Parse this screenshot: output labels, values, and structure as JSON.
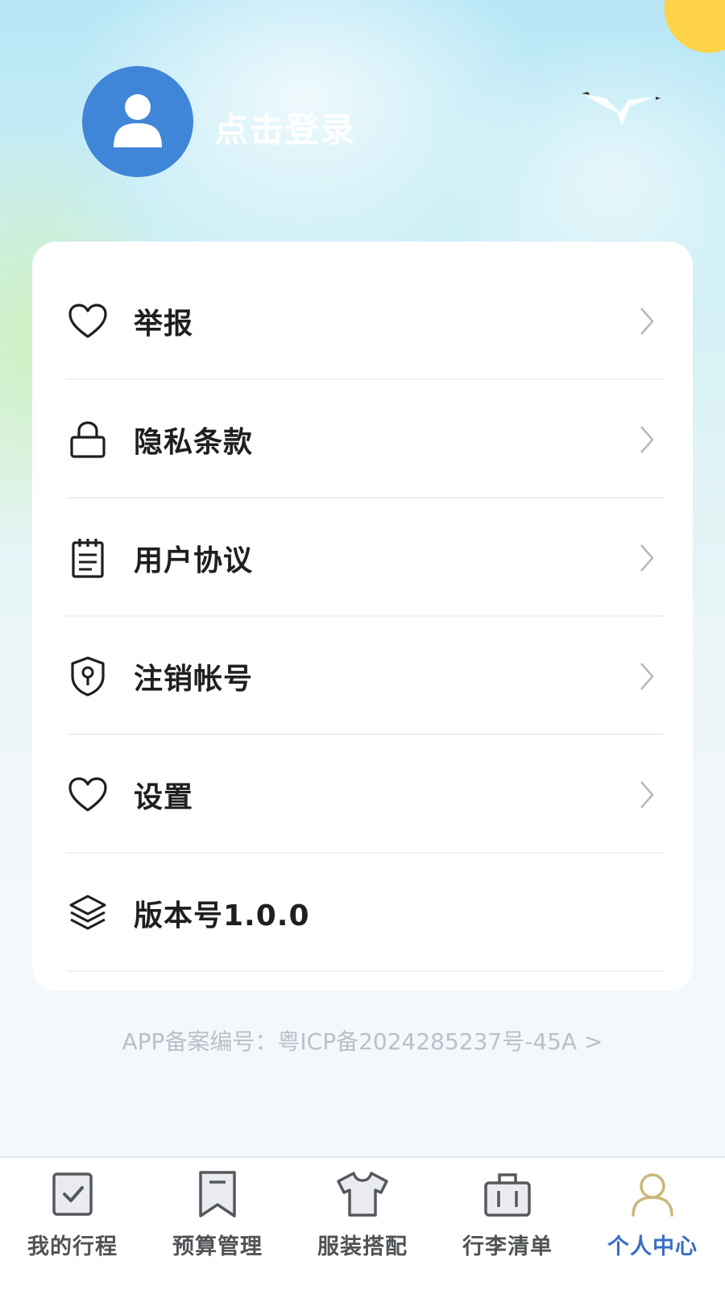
{
  "header": {
    "login_text": "点击登录",
    "avatar_color": "#3f86d8",
    "avatar_icon": "user-icon"
  },
  "menu": {
    "items": [
      {
        "label": "举报",
        "icon": "heart-icon",
        "has_chevron": true
      },
      {
        "label": "隐私条款",
        "icon": "lock-icon",
        "has_chevron": true
      },
      {
        "label": "用户协议",
        "icon": "notepad-icon",
        "has_chevron": true
      },
      {
        "label": "注销帐号",
        "icon": "shield-keyhole-icon",
        "has_chevron": true
      },
      {
        "label": "设置",
        "icon": "heart-icon",
        "has_chevron": true
      },
      {
        "label": "版本号1.0.0",
        "icon": "layers-icon",
        "has_chevron": false
      }
    ]
  },
  "footer": {
    "icp_text": "APP备案编号：粤ICP备2024285237号-45A >"
  },
  "tabbar": {
    "active_color": "#3a6fc4",
    "tabs": [
      {
        "label": "我的行程",
        "icon": "checklist-icon",
        "active": false
      },
      {
        "label": "预算管理",
        "icon": "bookmark-icon",
        "active": false
      },
      {
        "label": "服装搭配",
        "icon": "tshirt-icon",
        "active": false
      },
      {
        "label": "行李清单",
        "icon": "briefcase-icon",
        "active": false
      },
      {
        "label": "个人中心",
        "icon": "person-icon",
        "active": true
      }
    ]
  }
}
